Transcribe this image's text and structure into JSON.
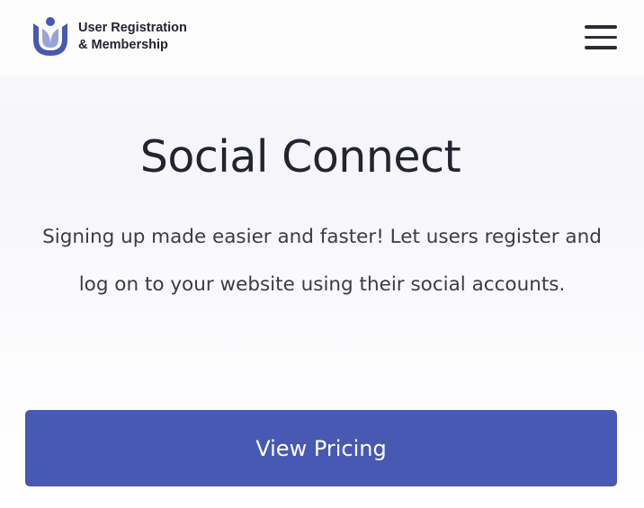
{
  "header": {
    "logo": {
      "line1": "User Registration",
      "line2": "& Membership",
      "icon": "user-registration-logo-icon",
      "color": "#4759b2"
    },
    "menu_icon": "hamburger-menu-icon"
  },
  "hero": {
    "title": "Social Connect",
    "description": "Signing up made easier and faster! Let users register and log on to your website using their social accounts.",
    "cta_label": "View Pricing"
  },
  "colors": {
    "accent": "#4759b2",
    "text_dark": "#222430",
    "text_body": "#3a3b44"
  }
}
